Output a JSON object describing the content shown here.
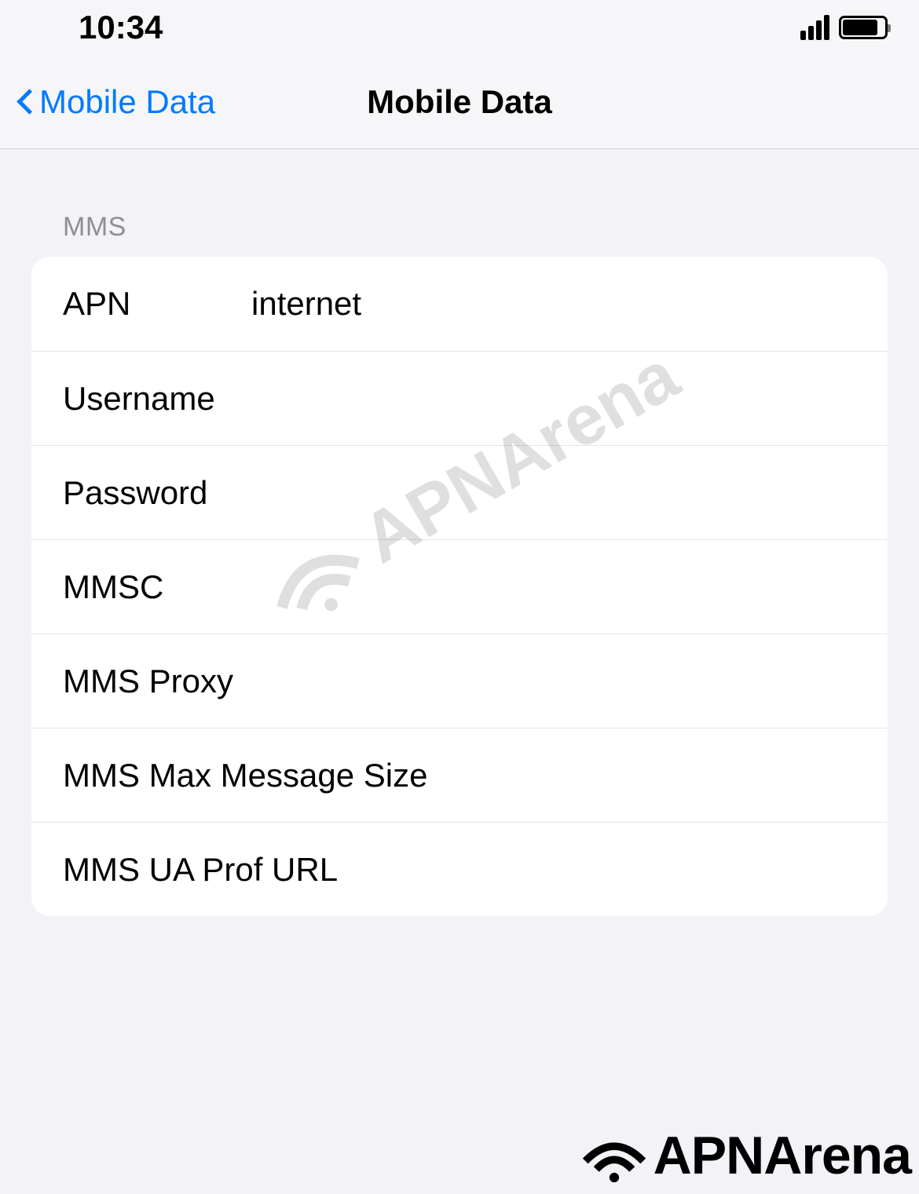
{
  "status_bar": {
    "time": "10:34"
  },
  "nav": {
    "back_label": "Mobile Data",
    "title": "Mobile Data"
  },
  "section": {
    "header": "MMS"
  },
  "fields": {
    "apn_label": "APN",
    "apn_value": "internet",
    "username_label": "Username",
    "username_value": "",
    "password_label": "Password",
    "password_value": "",
    "mmsc_label": "MMSC",
    "mmsc_value": "",
    "mms_proxy_label": "MMS Proxy",
    "mms_proxy_value": "",
    "mms_max_size_label": "MMS Max Message Size",
    "mms_max_size_value": "",
    "mms_ua_prof_label": "MMS UA Prof URL",
    "mms_ua_prof_value": ""
  },
  "watermark": {
    "text": "APNArena"
  }
}
